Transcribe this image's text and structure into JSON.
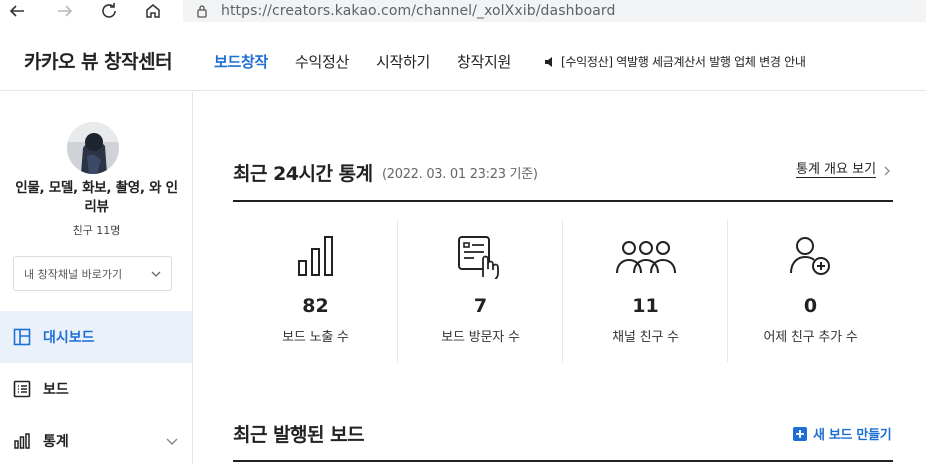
{
  "browser": {
    "url_host": "https://creators.kakao.com",
    "url_path": "/channel/_xolXxib/dashboard"
  },
  "header": {
    "brand": "카카오 뷰 창작센터",
    "nav": [
      "보드창작",
      "수익정산",
      "시작하기",
      "창작지원"
    ],
    "active_nav": 0,
    "notice": "[수익정산] 역발행 세금계산서 발행 업체 변경 안내"
  },
  "sidebar": {
    "channel_name": "인물, 모델, 화보, 촬영, 와 인리뷰",
    "friend_count": "친구 11명",
    "channel_select": "내 창작채널 바로가기",
    "menu": [
      {
        "label": "대시보드",
        "icon": "dashboard-icon",
        "active": true
      },
      {
        "label": "보드",
        "icon": "board-list-icon",
        "active": false
      },
      {
        "label": "통계",
        "icon": "bar-chart-icon",
        "active": false
      }
    ]
  },
  "stats_section": {
    "title": "최근 24시간 통계",
    "timestamp": "(2022. 03. 01 23:23 기준)",
    "overview_link": "통계 개요 보기",
    "items": [
      {
        "value": "82",
        "label": "보드 노출 수",
        "icon": "bar-chart-icon"
      },
      {
        "value": "7",
        "label": "보드 방문자 수",
        "icon": "board-tap-icon"
      },
      {
        "value": "11",
        "label": "채널 친구 수",
        "icon": "group-icon"
      },
      {
        "value": "0",
        "label": "어제 친구 추가 수",
        "icon": "add-user-icon"
      }
    ]
  },
  "recent_section": {
    "title": "최근 발행된 보드",
    "new_board": "새 보드 만들기"
  },
  "colors": {
    "accent": "#1d6fd6",
    "active_bg": "#ebf1fb"
  }
}
